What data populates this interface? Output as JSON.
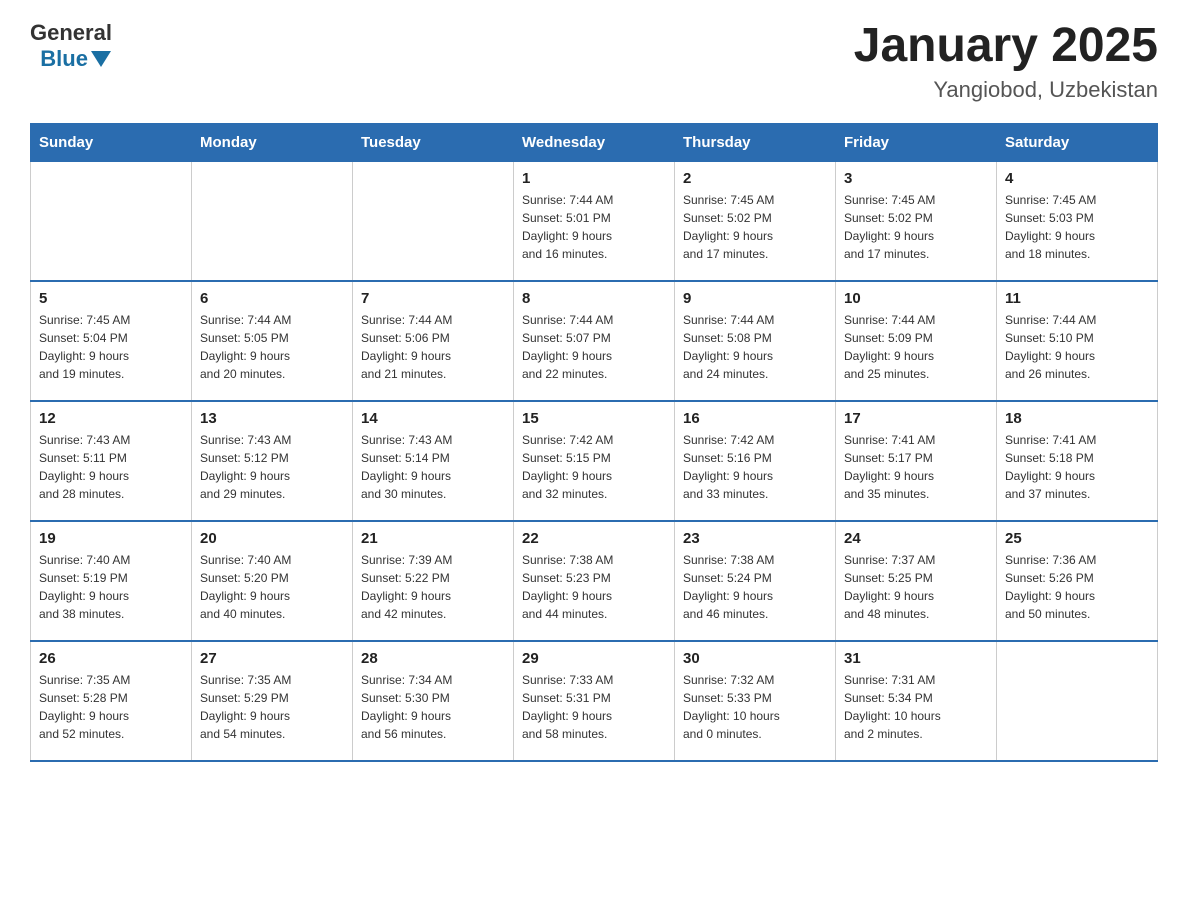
{
  "logo": {
    "general": "General",
    "blue": "Blue"
  },
  "header": {
    "title": "January 2025",
    "subtitle": "Yangiobod, Uzbekistan"
  },
  "days_of_week": [
    "Sunday",
    "Monday",
    "Tuesday",
    "Wednesday",
    "Thursday",
    "Friday",
    "Saturday"
  ],
  "weeks": [
    [
      {
        "day": "",
        "info": ""
      },
      {
        "day": "",
        "info": ""
      },
      {
        "day": "",
        "info": ""
      },
      {
        "day": "1",
        "info": "Sunrise: 7:44 AM\nSunset: 5:01 PM\nDaylight: 9 hours\nand 16 minutes."
      },
      {
        "day": "2",
        "info": "Sunrise: 7:45 AM\nSunset: 5:02 PM\nDaylight: 9 hours\nand 17 minutes."
      },
      {
        "day": "3",
        "info": "Sunrise: 7:45 AM\nSunset: 5:02 PM\nDaylight: 9 hours\nand 17 minutes."
      },
      {
        "day": "4",
        "info": "Sunrise: 7:45 AM\nSunset: 5:03 PM\nDaylight: 9 hours\nand 18 minutes."
      }
    ],
    [
      {
        "day": "5",
        "info": "Sunrise: 7:45 AM\nSunset: 5:04 PM\nDaylight: 9 hours\nand 19 minutes."
      },
      {
        "day": "6",
        "info": "Sunrise: 7:44 AM\nSunset: 5:05 PM\nDaylight: 9 hours\nand 20 minutes."
      },
      {
        "day": "7",
        "info": "Sunrise: 7:44 AM\nSunset: 5:06 PM\nDaylight: 9 hours\nand 21 minutes."
      },
      {
        "day": "8",
        "info": "Sunrise: 7:44 AM\nSunset: 5:07 PM\nDaylight: 9 hours\nand 22 minutes."
      },
      {
        "day": "9",
        "info": "Sunrise: 7:44 AM\nSunset: 5:08 PM\nDaylight: 9 hours\nand 24 minutes."
      },
      {
        "day": "10",
        "info": "Sunrise: 7:44 AM\nSunset: 5:09 PM\nDaylight: 9 hours\nand 25 minutes."
      },
      {
        "day": "11",
        "info": "Sunrise: 7:44 AM\nSunset: 5:10 PM\nDaylight: 9 hours\nand 26 minutes."
      }
    ],
    [
      {
        "day": "12",
        "info": "Sunrise: 7:43 AM\nSunset: 5:11 PM\nDaylight: 9 hours\nand 28 minutes."
      },
      {
        "day": "13",
        "info": "Sunrise: 7:43 AM\nSunset: 5:12 PM\nDaylight: 9 hours\nand 29 minutes."
      },
      {
        "day": "14",
        "info": "Sunrise: 7:43 AM\nSunset: 5:14 PM\nDaylight: 9 hours\nand 30 minutes."
      },
      {
        "day": "15",
        "info": "Sunrise: 7:42 AM\nSunset: 5:15 PM\nDaylight: 9 hours\nand 32 minutes."
      },
      {
        "day": "16",
        "info": "Sunrise: 7:42 AM\nSunset: 5:16 PM\nDaylight: 9 hours\nand 33 minutes."
      },
      {
        "day": "17",
        "info": "Sunrise: 7:41 AM\nSunset: 5:17 PM\nDaylight: 9 hours\nand 35 minutes."
      },
      {
        "day": "18",
        "info": "Sunrise: 7:41 AM\nSunset: 5:18 PM\nDaylight: 9 hours\nand 37 minutes."
      }
    ],
    [
      {
        "day": "19",
        "info": "Sunrise: 7:40 AM\nSunset: 5:19 PM\nDaylight: 9 hours\nand 38 minutes."
      },
      {
        "day": "20",
        "info": "Sunrise: 7:40 AM\nSunset: 5:20 PM\nDaylight: 9 hours\nand 40 minutes."
      },
      {
        "day": "21",
        "info": "Sunrise: 7:39 AM\nSunset: 5:22 PM\nDaylight: 9 hours\nand 42 minutes."
      },
      {
        "day": "22",
        "info": "Sunrise: 7:38 AM\nSunset: 5:23 PM\nDaylight: 9 hours\nand 44 minutes."
      },
      {
        "day": "23",
        "info": "Sunrise: 7:38 AM\nSunset: 5:24 PM\nDaylight: 9 hours\nand 46 minutes."
      },
      {
        "day": "24",
        "info": "Sunrise: 7:37 AM\nSunset: 5:25 PM\nDaylight: 9 hours\nand 48 minutes."
      },
      {
        "day": "25",
        "info": "Sunrise: 7:36 AM\nSunset: 5:26 PM\nDaylight: 9 hours\nand 50 minutes."
      }
    ],
    [
      {
        "day": "26",
        "info": "Sunrise: 7:35 AM\nSunset: 5:28 PM\nDaylight: 9 hours\nand 52 minutes."
      },
      {
        "day": "27",
        "info": "Sunrise: 7:35 AM\nSunset: 5:29 PM\nDaylight: 9 hours\nand 54 minutes."
      },
      {
        "day": "28",
        "info": "Sunrise: 7:34 AM\nSunset: 5:30 PM\nDaylight: 9 hours\nand 56 minutes."
      },
      {
        "day": "29",
        "info": "Sunrise: 7:33 AM\nSunset: 5:31 PM\nDaylight: 9 hours\nand 58 minutes."
      },
      {
        "day": "30",
        "info": "Sunrise: 7:32 AM\nSunset: 5:33 PM\nDaylight: 10 hours\nand 0 minutes."
      },
      {
        "day": "31",
        "info": "Sunrise: 7:31 AM\nSunset: 5:34 PM\nDaylight: 10 hours\nand 2 minutes."
      },
      {
        "day": "",
        "info": ""
      }
    ]
  ]
}
